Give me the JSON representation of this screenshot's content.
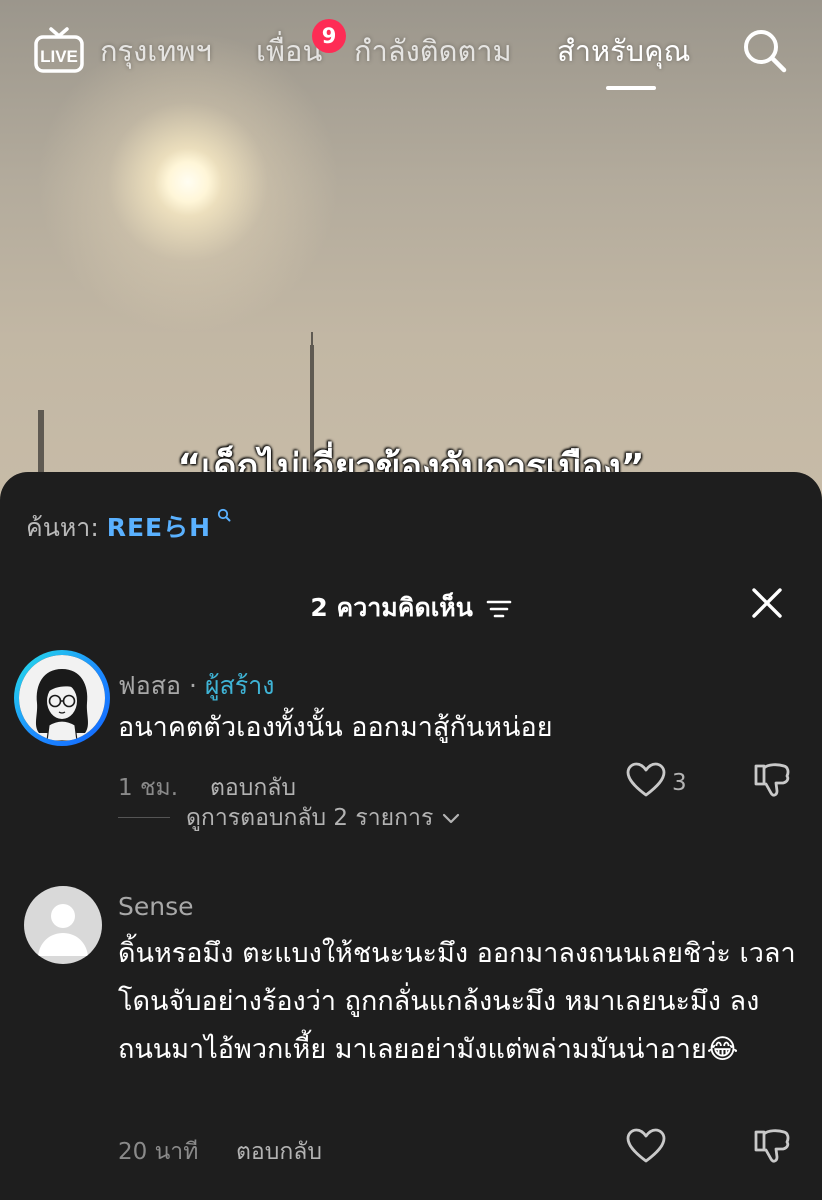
{
  "nav": {
    "live_label": "LIVE",
    "tabs": [
      {
        "label": "กรุงเทพฯ",
        "active": false
      },
      {
        "label": "เพื่อน",
        "active": false
      },
      {
        "label": "กำลังติดตาม",
        "active": false
      },
      {
        "label": "สำหรับคุณ",
        "active": true
      }
    ],
    "friends_badge": "9",
    "search_icon": "search-icon"
  },
  "video": {
    "caption": "“เด็กไม่เกี่ยวข้องกับการเมือง”"
  },
  "comments_sheet": {
    "suggested_search": {
      "prefix": "ค้นหา:",
      "term": "REEらH"
    },
    "header": {
      "count_label": "2 ความคิดเห็น"
    },
    "comments": [
      {
        "username": "ฟอสอ",
        "separator": "·",
        "creator_tag": "ผู้สร้าง",
        "text": "อนาคตตัวเองทั้งนั้น ออกมาสู้กันหน่อย",
        "time": "1 ชม.",
        "reply_label": "ตอบกลับ",
        "likes": "3",
        "view_replies": "ดูการตอบกลับ 2 รายการ"
      },
      {
        "username": "Sense",
        "text": "ดิ้นหรอมึง ตะแบงให้ชนะนะมึง ออกมาลงถนนเลยชิว่ะ เวลาโดนจับอย่างร้องว่า ถูกกลั่นแกล้งนะมึง หมาเลยนะมึง ลงถนนมาไอ้พวกเหี้ย มาเลยอย่ามังแต่พล่ามมันน่าอาย😂",
        "time": "20 นาที",
        "reply_label": "ตอบกลับ"
      }
    ]
  },
  "colors": {
    "sheet_bg": "#1e1e1e",
    "badge": "#fe2c55",
    "creator_tag": "#3fb4d6",
    "search_term": "#5ab1ff"
  }
}
